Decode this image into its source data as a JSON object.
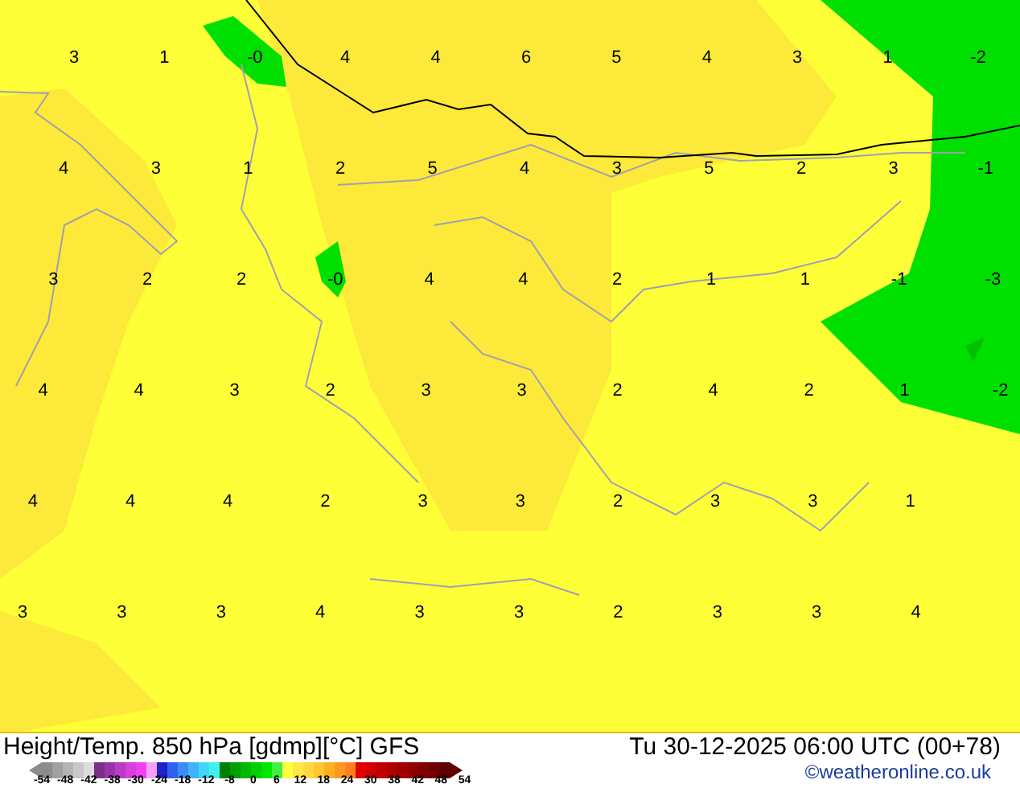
{
  "map": {
    "value_rows": [
      [
        "3",
        "1",
        "-0",
        "4",
        "4",
        "6",
        "5",
        "4",
        "3",
        "1",
        "-2"
      ],
      [
        "4",
        "3",
        "1",
        "2",
        "5",
        "4",
        "3",
        "5",
        "2",
        "3",
        "-1"
      ],
      [
        "3",
        "2",
        "2",
        "-0",
        "4",
        "4",
        "2",
        "1",
        "1",
        "-1",
        "-3"
      ],
      [
        "4",
        "4",
        "3",
        "2",
        "3",
        "3",
        "2",
        "4",
        "2",
        "1",
        "-2"
      ],
      [
        "4",
        "4",
        "4",
        "2",
        "3",
        "3",
        "2",
        "3",
        "3",
        "1"
      ],
      [
        "3",
        "3",
        "3",
        "4",
        "3",
        "3",
        "2",
        "3",
        "3",
        "4"
      ]
    ]
  },
  "footer": {
    "title": "Height/Temp. 850 hPa [gdmp][°C] GFS",
    "datetime": "Tu 30-12-2025 06:00 UTC (00+78)",
    "copyright": "©weatheronline.co.uk",
    "legend_labels": [
      "-54",
      "-48",
      "-42",
      "-38",
      "-30",
      "-24",
      "-18",
      "-12",
      "-8",
      "0",
      "6",
      "12",
      "18",
      "24",
      "30",
      "38",
      "42",
      "48",
      "54"
    ]
  }
}
